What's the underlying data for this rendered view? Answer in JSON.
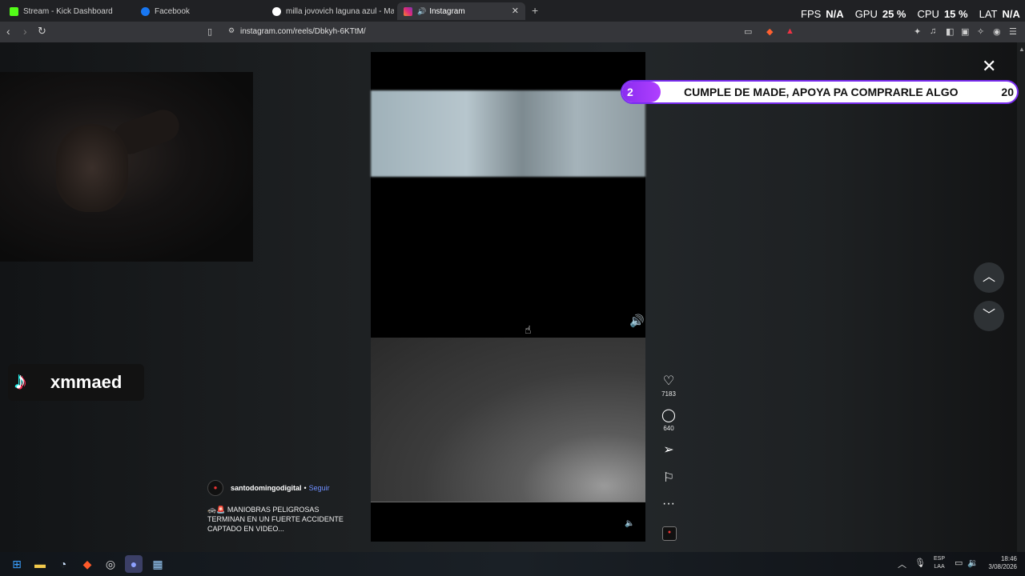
{
  "tabs": [
    {
      "title": "Stream - Kick Dashboard",
      "favicon": "kick-icon",
      "color": "#53fc18"
    },
    {
      "title": "Facebook",
      "favicon": "facebook-icon",
      "color": "#1877f2"
    },
    {
      "title": "milla jovovich laguna azul - Mask'ara",
      "favicon": "google-icon",
      "color": "#ffffff"
    },
    {
      "title": "Instagram",
      "favicon": "instagram-icon",
      "color": "#e1306c"
    }
  ],
  "tab_audio_icon": "🔊",
  "tab_close": "✕",
  "new_tab": "+",
  "address_url": "instagram.com/reels/Dbkyh-6KTtM/",
  "overlay_stats": {
    "fps_label": "FPS",
    "fps_value": "N/A",
    "gpu_label": "GPU",
    "gpu_value": "25 %",
    "cpu_label": "CPU",
    "cpu_value": "15 %",
    "lat_label": "LAT",
    "lat_value": "N/A"
  },
  "donation_banner": {
    "count": "2",
    "message": "CUMPLE DE MADE, APOYA PA COMPRARLE ALGO",
    "goal": "20",
    "accent": "#8a2cf0"
  },
  "streamer": {
    "handle": "xmmaed"
  },
  "reel": {
    "author": "santodomingodigital",
    "follow_label": "Seguir",
    "caption": "🚓🚨 MANIOBRAS PELIGROSAS TERMINAN EN UN FUERTE ACCIDENTE CAPTADO EN VIDEO...",
    "likes": "7183",
    "comments": "640"
  },
  "taskbar": {
    "lang_1": "ESP",
    "lang_2": "LAA",
    "time": "18:46",
    "date": "3/08/2026"
  }
}
